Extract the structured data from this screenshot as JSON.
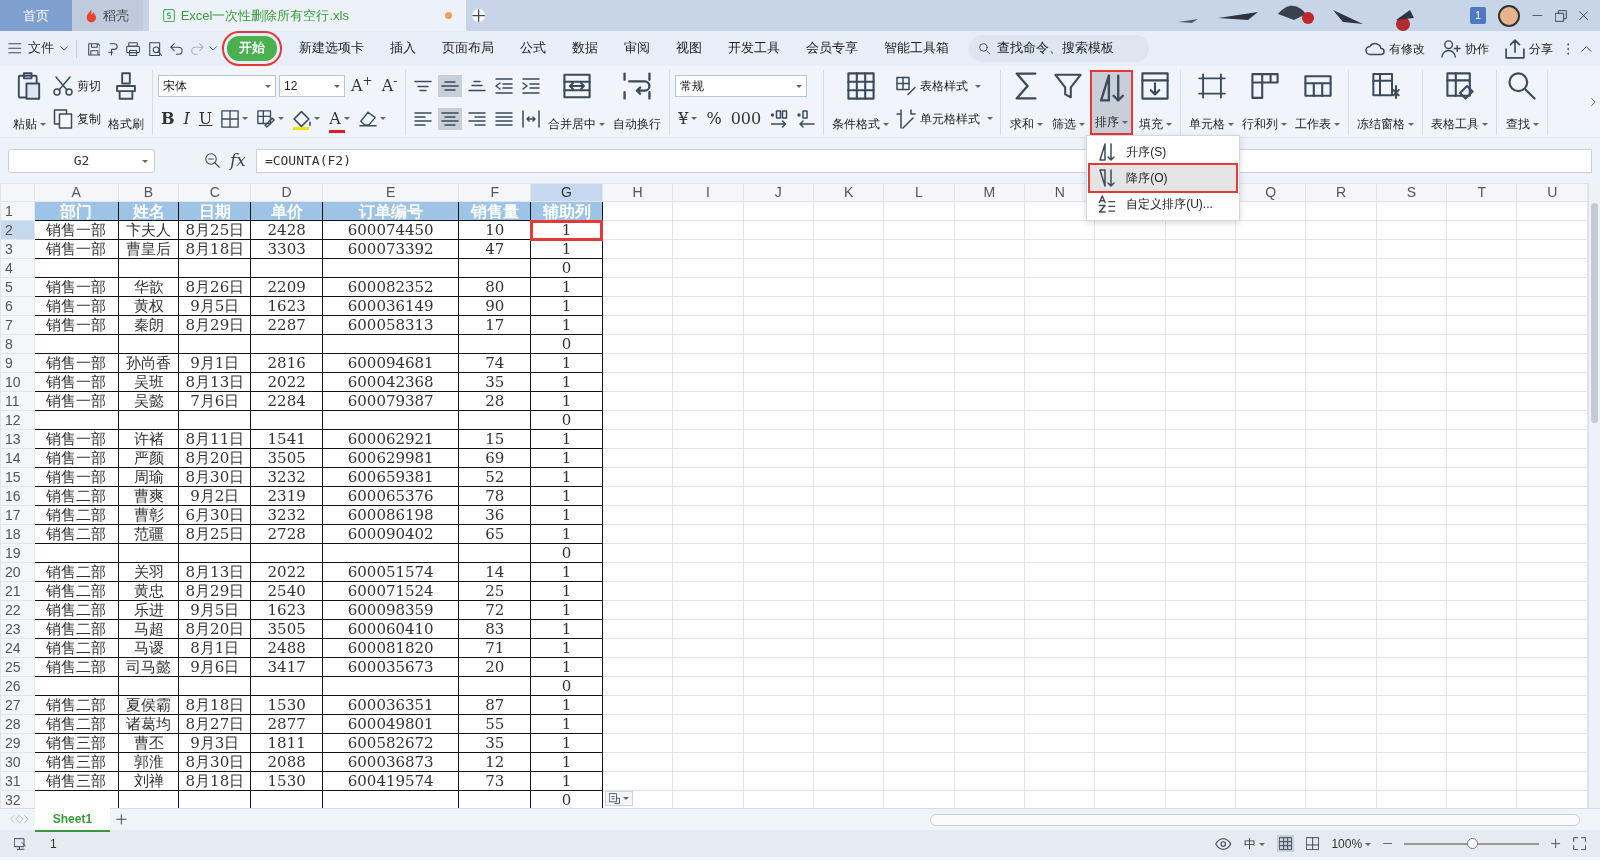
{
  "tabs": [
    {
      "label": "首页",
      "selected": false,
      "unsaved": false
    },
    {
      "label": "稻壳",
      "selected": false,
      "unsaved": false
    },
    {
      "label": "Excel一次性删除所有空行.xls",
      "selected": true,
      "unsaved": true
    }
  ],
  "notification_count": "1",
  "menu": {
    "file": "文件",
    "quick_access": [
      {
        "disabled": false
      },
      {
        "disabled": false
      },
      {
        "disabled": false
      },
      {
        "disabled": false
      },
      {
        "disabled": false
      },
      {
        "disabled": true
      }
    ],
    "tabs": [
      {
        "label": "开始",
        "selected": true,
        "highlighted": true
      },
      {
        "label": "新建选项卡",
        "selected": false,
        "highlighted": false
      },
      {
        "label": "插入",
        "selected": false,
        "highlighted": false
      },
      {
        "label": "页面布局",
        "selected": false,
        "highlighted": false
      },
      {
        "label": "公式",
        "selected": false,
        "highlighted": false
      },
      {
        "label": "数据",
        "selected": false,
        "highlighted": false
      },
      {
        "label": "审阅",
        "selected": false,
        "highlighted": false
      },
      {
        "label": "视图",
        "selected": false,
        "highlighted": false
      },
      {
        "label": "开发工具",
        "selected": false,
        "highlighted": false
      },
      {
        "label": "会员专享",
        "selected": false,
        "highlighted": false
      },
      {
        "label": "智能工具箱",
        "selected": false,
        "highlighted": false
      }
    ],
    "search": {
      "placeholder": "查找命令、搜索模板"
    },
    "actions": [
      "有修改",
      "协作",
      "分享"
    ]
  },
  "ribbon": {
    "groups": [
      {
        "items": [
          {
            "kind": "large",
            "label": "粘贴",
            "dropdown": true
          },
          {
            "kind": "stack",
            "items": [
              {
                "label": "剪切",
                "dropdown": false
              },
              {
                "label": "复制",
                "dropdown": false
              }
            ]
          },
          {
            "kind": "large",
            "label": "格式刷",
            "dropdown": false
          }
        ]
      },
      {
        "items": [
          {
            "kind": "tools",
            "rows": [
              [
                {
                  "kind": "field",
                  "value": "宋体",
                  "dropdown": true
                },
                {
                  "kind": "field",
                  "value": "12",
                  "dropdown": true
                },
                {
                  "kind": "text",
                  "label": "A$^{+}$"
                },
                {
                  "kind": "text",
                  "label": "A$^{-}$"
                }
              ],
              [
                {
                  "kind": "text",
                  "label": "B"
                },
                {
                  "kind": "text",
                  "label": "I"
                },
                {
                  "kind": "text",
                  "label": "U"
                },
                {
                  "kind": "icon",
                  "dropdown": true
                },
                {
                  "kind": "icon",
                  "dropdown": true
                },
                {
                  "kind": "icon",
                  "dropdown": true,
                  "color": "#f2e200"
                },
                {
                  "kind": "text",
                  "label": "A",
                  "dropdown": true,
                  "color": "#e0201c"
                },
                {
                  "kind": "icon",
                  "dropdown": true
                }
              ]
            ]
          }
        ]
      },
      {
        "items": [
          {
            "kind": "tools",
            "rows": [
              [
                {
                  "kind": "icon",
                  "selected": false
                },
                {
                  "kind": "icon",
                  "selected": true
                },
                {
                  "kind": "icon",
                  "selected": false
                },
                {
                  "kind": "icon",
                  "selected": false
                },
                {
                  "kind": "icon",
                  "selected": false
                }
              ],
              [
                {
                  "kind": "icon",
                  "selected": false
                },
                {
                  "kind": "icon",
                  "selected": true
                },
                {
                  "kind": "icon",
                  "selected": false
                },
                {
                  "kind": "icon",
                  "selected": false
                },
                {
                  "kind": "icon",
                  "selected": false
                }
              ]
            ]
          },
          {
            "kind": "large",
            "label": "合并居中",
            "dropdown": true
          },
          {
            "kind": "large",
            "label": "自动换行",
            "dropdown": false
          }
        ]
      },
      {
        "items": [
          {
            "kind": "tools",
            "rows": [
              [
                {
                  "kind": "field",
                  "value": "常规",
                  "dropdown": true
                }
              ],
              [
                {
                  "kind": "text",
                  "label": "¥",
                  "dropdown": true
                },
                {
                  "kind": "text",
                  "label": "%"
                },
                {
                  "kind": "text",
                  "label": "000"
                },
                {
                  "kind": "icon"
                },
                {
                  "kind": "icon"
                }
              ]
            ]
          }
        ]
      },
      {
        "items": [
          {
            "kind": "large",
            "label": "条件格式",
            "dropdown": true
          },
          {
            "kind": "stack",
            "items": [
              {
                "label": "表格样式",
                "dropdown": true
              },
              {
                "label": "单元格样式",
                "dropdown": true
              }
            ]
          }
        ]
      },
      {
        "items": [
          {
            "kind": "large",
            "label": "求和",
            "dropdown": true
          },
          {
            "kind": "large",
            "label": "筛选",
            "dropdown": true
          },
          {
            "kind": "large",
            "label": "排序",
            "dropdown": true,
            "highlighted": true,
            "expanded": true,
            "menu": [
              {
                "label": "升序(S)",
                "selected": false,
                "highlighted": false
              },
              {
                "label": "降序(O)",
                "selected": true,
                "highlighted": true
              },
              {
                "label": "自定义排序(U)...",
                "selected": false,
                "highlighted": false
              }
            ]
          },
          {
            "kind": "large",
            "label": "填充",
            "dropdown": true
          }
        ]
      },
      {
        "items": [
          {
            "kind": "large",
            "label": "单元格",
            "dropdown": true
          },
          {
            "kind": "large",
            "label": "行和列",
            "dropdown": true
          },
          {
            "kind": "large",
            "label": "工作表",
            "dropdown": true
          }
        ]
      },
      {
        "items": [
          {
            "kind": "large",
            "label": "冻结窗格",
            "dropdown": true
          }
        ]
      },
      {
        "items": [
          {
            "kind": "large",
            "label": "表格工具",
            "dropdown": true
          }
        ]
      },
      {
        "items": [
          {
            "kind": "large",
            "label": "查找",
            "dropdown": true
          }
        ]
      }
    ]
  },
  "name_box": "G2",
  "fx_label": "fx",
  "formula": "=COUNTA(F2)",
  "sheet": {
    "columns": [
      {
        "label": "A",
        "selected": false
      },
      {
        "label": "B",
        "selected": false
      },
      {
        "label": "C",
        "selected": false
      },
      {
        "label": "D",
        "selected": false
      },
      {
        "label": "E",
        "selected": false
      },
      {
        "label": "F",
        "selected": false
      },
      {
        "label": "G",
        "selected": true
      },
      {
        "label": "H",
        "selected": false
      },
      {
        "label": "I",
        "selected": false
      },
      {
        "label": "J",
        "selected": false
      },
      {
        "label": "K",
        "selected": false
      },
      {
        "label": "L",
        "selected": false
      },
      {
        "label": "M",
        "selected": false
      },
      {
        "label": "N",
        "selected": false
      }
    ],
    "columns_after_menu": [
      {
        "label": "Q",
        "selected": false
      },
      {
        "label": "R",
        "selected": false
      },
      {
        "label": "S",
        "selected": false
      },
      {
        "label": "T",
        "selected": false
      },
      {
        "label": "U",
        "selected": false
      }
    ],
    "rows": [
      {
        "num": "1",
        "kind": "header",
        "selected": false,
        "cells": {
          "A": "部门",
          "B": "姓名",
          "C": "日期",
          "D": "单价",
          "E": "订单编号",
          "F": "销售量",
          "G": "辅助列"
        }
      },
      {
        "num": "2",
        "selected": true,
        "cells": {
          "A": "销售一部",
          "B": "卞夫人",
          "C": "8月25日",
          "D": "2428",
          "E": "600074450",
          "F": "10",
          "G": "1"
        }
      },
      {
        "num": "3",
        "selected": false,
        "cells": {
          "A": "销售一部",
          "B": "曹皇后",
          "C": "8月18日",
          "D": "3303",
          "E": "600073392",
          "F": "47",
          "G": "1"
        }
      },
      {
        "num": "4",
        "selected": false,
        "cells": {
          "G": "0"
        }
      },
      {
        "num": "5",
        "selected": false,
        "cells": {
          "A": "销售一部",
          "B": "华歆",
          "C": "8月26日",
          "D": "2209",
          "E": "600082352",
          "F": "80",
          "G": "1"
        }
      },
      {
        "num": "6",
        "selected": false,
        "cells": {
          "A": "销售一部",
          "B": "黄权",
          "C": "9月5日",
          "D": "1623",
          "E": "600036149",
          "F": "90",
          "G": "1"
        }
      },
      {
        "num": "7",
        "selected": false,
        "cells": {
          "A": "销售一部",
          "B": "秦朗",
          "C": "8月29日",
          "D": "2287",
          "E": "600058313",
          "F": "17",
          "G": "1"
        }
      },
      {
        "num": "8",
        "selected": false,
        "cells": {
          "G": "0"
        }
      },
      {
        "num": "9",
        "selected": false,
        "cells": {
          "A": "销售一部",
          "B": "孙尚香",
          "C": "9月1日",
          "D": "2816",
          "E": "600094681",
          "F": "74",
          "G": "1"
        }
      },
      {
        "num": "10",
        "selected": false,
        "cells": {
          "A": "销售一部",
          "B": "吴班",
          "C": "8月13日",
          "D": "2022",
          "E": "600042368",
          "F": "35",
          "G": "1"
        }
      },
      {
        "num": "11",
        "selected": false,
        "cells": {
          "A": "销售一部",
          "B": "吴懿",
          "C": "7月6日",
          "D": "2284",
          "E": "600079387",
          "F": "28",
          "G": "1"
        }
      },
      {
        "num": "12",
        "selected": false,
        "cells": {
          "G": "0"
        }
      },
      {
        "num": "13",
        "selected": false,
        "cells": {
          "A": "销售一部",
          "B": "许褚",
          "C": "8月11日",
          "D": "1541",
          "E": "600062921",
          "F": "15",
          "G": "1"
        }
      },
      {
        "num": "14",
        "selected": false,
        "cells": {
          "A": "销售一部",
          "B": "严颜",
          "C": "8月20日",
          "D": "3505",
          "E": "600629981",
          "F": "69",
          "G": "1"
        }
      },
      {
        "num": "15",
        "selected": false,
        "cells": {
          "A": "销售一部",
          "B": "周瑜",
          "C": "8月30日",
          "D": "3232",
          "E": "600659381",
          "F": "52",
          "G": "1"
        }
      },
      {
        "num": "16",
        "selected": false,
        "cells": {
          "A": "销售二部",
          "B": "曹爽",
          "C": "9月2日",
          "D": "2319",
          "E": "600065376",
          "F": "78",
          "G": "1"
        }
      },
      {
        "num": "17",
        "selected": false,
        "cells": {
          "A": "销售二部",
          "B": "曹彰",
          "C": "6月30日",
          "D": "3232",
          "E": "600086198",
          "F": "36",
          "G": "1"
        }
      },
      {
        "num": "18",
        "selected": false,
        "cells": {
          "A": "销售二部",
          "B": "范疆",
          "C": "8月25日",
          "D": "2728",
          "E": "600090402",
          "F": "65",
          "G": "1"
        }
      },
      {
        "num": "19",
        "selected": false,
        "cells": {
          "G": "0"
        }
      },
      {
        "num": "20",
        "selected": false,
        "cells": {
          "A": "销售二部",
          "B": "关羽",
          "C": "8月13日",
          "D": "2022",
          "E": "600051574",
          "F": "14",
          "G": "1"
        }
      },
      {
        "num": "21",
        "selected": false,
        "cells": {
          "A": "销售二部",
          "B": "黄忠",
          "C": "8月29日",
          "D": "2540",
          "E": "600071524",
          "F": "25",
          "G": "1"
        }
      },
      {
        "num": "22",
        "selected": false,
        "cells": {
          "A": "销售二部",
          "B": "乐进",
          "C": "9月5日",
          "D": "1623",
          "E": "600098359",
          "F": "72",
          "G": "1"
        }
      },
      {
        "num": "23",
        "selected": false,
        "cells": {
          "A": "销售二部",
          "B": "马超",
          "C": "8月20日",
          "D": "3505",
          "E": "600060410",
          "F": "83",
          "G": "1"
        }
      },
      {
        "num": "24",
        "selected": false,
        "cells": {
          "A": "销售二部",
          "B": "马谡",
          "C": "8月1日",
          "D": "2488",
          "E": "600081820",
          "F": "71",
          "G": "1"
        }
      },
      {
        "num": "25",
        "selected": false,
        "cells": {
          "A": "销售二部",
          "B": "司马懿",
          "C": "9月6日",
          "D": "3417",
          "E": "600035673",
          "F": "20",
          "G": "1"
        }
      },
      {
        "num": "26",
        "selected": false,
        "cells": {
          "G": "0"
        }
      },
      {
        "num": "27",
        "selected": false,
        "cells": {
          "A": "销售二部",
          "B": "夏侯霸",
          "C": "8月18日",
          "D": "1530",
          "E": "600036351",
          "F": "87",
          "G": "1"
        }
      },
      {
        "num": "28",
        "selected": false,
        "cells": {
          "A": "销售二部",
          "B": "诸葛均",
          "C": "8月27日",
          "D": "2877",
          "E": "600049801",
          "F": "55",
          "G": "1"
        }
      },
      {
        "num": "29",
        "selected": false,
        "cells": {
          "A": "销售三部",
          "B": "曹丕",
          "C": "9月3日",
          "D": "1811",
          "E": "600582672",
          "F": "35",
          "G": "1"
        }
      },
      {
        "num": "30",
        "selected": false,
        "cells": {
          "A": "销售三部",
          "B": "郭淮",
          "C": "8月30日",
          "D": "2088",
          "E": "600036873",
          "F": "12",
          "G": "1"
        }
      },
      {
        "num": "31",
        "selected": false,
        "cells": {
          "A": "销售三部",
          "B": "刘禅",
          "C": "8月18日",
          "D": "1530",
          "E": "600419574",
          "F": "73",
          "G": "1"
        }
      },
      {
        "num": "32",
        "selected": false,
        "cells": {
          "G": "0"
        }
      }
    ]
  },
  "sheet_tabs": [
    {
      "label": "Sheet1",
      "selected": true
    }
  ],
  "status": {
    "page": "1",
    "input_mode": "中",
    "zoom": "100%",
    "zoom_level": {
      "level": 0.5
    }
  }
}
